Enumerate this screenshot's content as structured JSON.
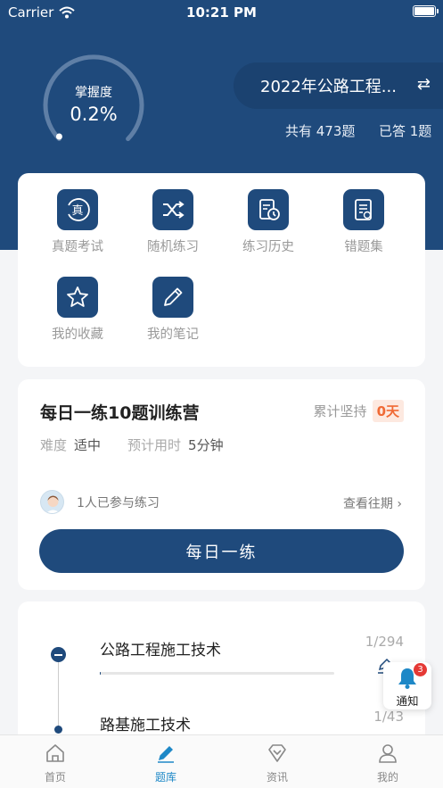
{
  "status_bar": {
    "carrier": "Carrier",
    "time": "10:21 PM"
  },
  "mastery": {
    "label": "掌握度",
    "value": "0.2%",
    "percent": 0.2
  },
  "subject": {
    "name": "2022年公路工程...",
    "switch_icon": "swap-arrows-icon"
  },
  "counts": {
    "total": "共有 473题",
    "answered": "已答 1题"
  },
  "quick_actions": [
    {
      "label": "真题考试",
      "icon": "real-exam-icon"
    },
    {
      "label": "随机练习",
      "icon": "shuffle-icon"
    },
    {
      "label": "练习历史",
      "icon": "history-icon"
    },
    {
      "label": "错题集",
      "icon": "wrong-questions-icon"
    },
    {
      "label": "我的收藏",
      "icon": "star-icon"
    },
    {
      "label": "我的笔记",
      "icon": "pencil-icon"
    }
  ],
  "daily": {
    "title": "每日一练10题训练营",
    "streak_label": "累计坚持",
    "streak_value": "0天",
    "difficulty_label": "难度",
    "difficulty_value": "适中",
    "time_label": "预计用时",
    "time_value": "5分钟",
    "participants": "1人已参与练习",
    "history_link": "查看往期 ›",
    "button": "每日一练"
  },
  "chapters": [
    {
      "name": "公路工程施工技术",
      "progress": "1/294"
    },
    {
      "name": "路基施工技术",
      "progress": "1/43"
    }
  ],
  "notify": {
    "label": "通知",
    "badge": "3"
  },
  "tabs": [
    {
      "label": "首页",
      "icon": "home-icon"
    },
    {
      "label": "题库",
      "icon": "pen-icon"
    },
    {
      "label": "资讯",
      "icon": "diamond-icon"
    },
    {
      "label": "我的",
      "icon": "user-icon"
    }
  ],
  "colors": {
    "primary": "#1f4a7c",
    "active_tab": "#1e88c7",
    "streak": "#f06a35",
    "badge": "#e53935"
  }
}
